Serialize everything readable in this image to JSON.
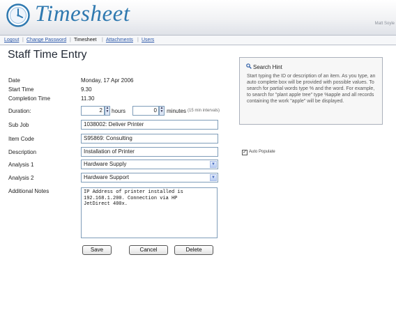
{
  "app": {
    "logo": "Timesheet",
    "user": "Matt Soyle"
  },
  "nav": {
    "logout": "Logout",
    "change_password": "Change Password",
    "timesheet": "Timesheet",
    "attachments": "Attachments",
    "users": "Users",
    "separator": "|"
  },
  "page": {
    "title": "Staff Time Entry"
  },
  "form": {
    "date_label": "Date",
    "date_value": "Monday, 17 Apr 2006",
    "start_label": "Start Time",
    "start_value": "9.30",
    "completion_label": "Completion Time",
    "completion_value": "11.30",
    "duration_label": "Duration:",
    "hours_value": "2",
    "hours_label": "hours",
    "minutes_value": "0",
    "minutes_label": "minutes",
    "interval_note": "(15 min intervals)",
    "subjob_label": "Sub Job",
    "subjob_value": "1038002: Deliver Printer",
    "item_label": "Item Code",
    "item_value": "S95869: Consulting",
    "desc_label": "Description",
    "desc_value": "Installation of Printer",
    "analysis1_label": "Analysis 1",
    "analysis1_value": "Hardware Supply",
    "analysis2_label": "Analysis 2",
    "analysis2_value": "Hardware Support",
    "notes_label": "Additional Notes",
    "notes_value": "IP Address of printer installed is\n192.168.1.200. Connection via HP\nJetDirect 400x.",
    "auto_populate_label": "Auto Populate"
  },
  "buttons": {
    "save": "Save",
    "cancel": "Cancel",
    "delete": "Delete"
  },
  "hint": {
    "title": "Search Hint",
    "body": "Start typing the ID or description of an item. As you type, an auto complete box will be provided with possible values. To search for partial words type % and the word. For example, to search for \"plant apple tree\" type %apple and all records containing the work \"apple\" will be displayed."
  },
  "colors": {
    "accent": "#2f79b0",
    "link": "#2a56a8",
    "border": "#7f9db9"
  }
}
